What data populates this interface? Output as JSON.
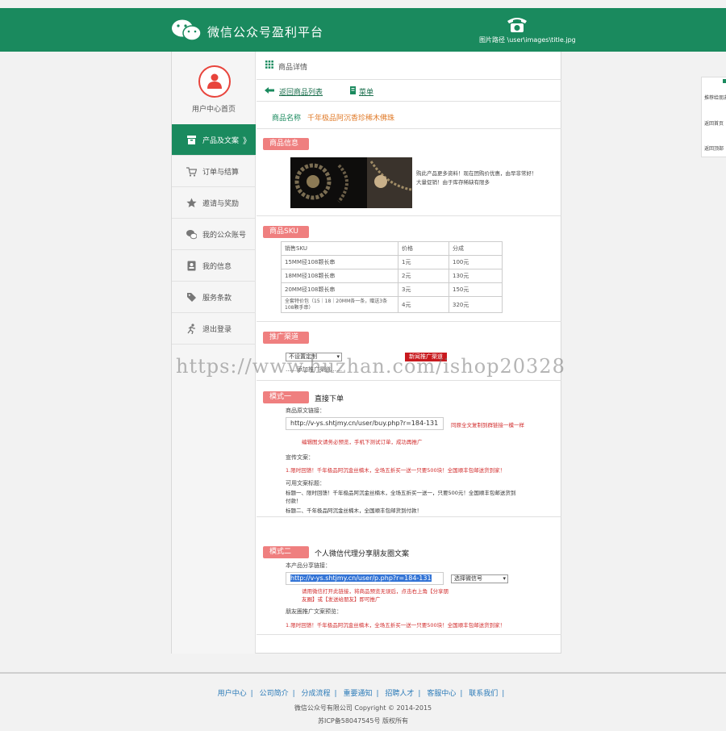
{
  "header": {
    "title": "微信公众号盈利平台",
    "image_path": "图片路径 \\user\\images\\title.jpg"
  },
  "sidebar": {
    "user_home": "用户中心首页",
    "items": [
      {
        "label": "产品及文案",
        "arrow": "》"
      },
      {
        "label": "订单与结算"
      },
      {
        "label": "邀请与奖励"
      },
      {
        "label": "我的公众账号"
      },
      {
        "label": "我的信息"
      },
      {
        "label": "服务条款"
      },
      {
        "label": "退出登录"
      }
    ]
  },
  "main": {
    "section_title": "商品详情",
    "back_link": "返回商品列表",
    "list_link": "菜单",
    "product_name_label": "商品名称",
    "product_name": "千年极品阿沉香珍稀木佛珠",
    "info_badge": "商品信息",
    "description": "购此产品更多资料！现在团购价优惠，由早非常好！大量促销！由于库存稀缺有限多",
    "sku_badge": "商品SKU",
    "sku_table": {
      "headers": [
        "销售SKU",
        "价格",
        "分成"
      ],
      "rows": [
        [
          "15MM径108颗长串",
          "1元",
          "100元"
        ],
        [
          "18MM径108颗长串",
          "2元",
          "130元"
        ],
        [
          "20MM径108颗长串",
          "3元",
          "150元"
        ],
        [
          "全套特价包（15｜18｜20MM各一条，赠送3条108颗手串）",
          "4元",
          "320元"
        ]
      ]
    },
    "promo_badge": "推广渠道",
    "promo_select": "不设置定制",
    "promo_button": "新闻推广渠道",
    "promo_note": "……添加推广渠道……",
    "mode1": {
      "badge": "模式一",
      "title": "直接下单",
      "url_label": "商品原文链接：",
      "url": "http://v-ys.shtjmy.cn/user/buy.php?r=184-131",
      "copy_hint": "同原全文复制到群链接一模一样",
      "warn": "编辑图文请务必预览，手机下测试订单，成功再推广",
      "copy_label": "宣传文案：",
      "copy_text": "1.限时回馈！千年极品阿沉金丝楠木，全场五折买一送一只要500块！全国顺丰包邮送货到家！",
      "titles_label": "可用文案标题：",
      "title1": "标题一、限时回馈！千年极品阿沉金丝楠木，全场五折买一送一，只要500元！全国顺丰包邮送货到付款！",
      "title2": "标题二、千年极品阿沉金丝楠木，全国顺丰包邮货到付款！"
    },
    "mode2": {
      "badge": "模式二",
      "title": "个人微信代理分享朋友圈文案",
      "url_label": "本产品分享链接：",
      "url": "http://v-ys.shtjmy.cn/user/p.php?r=184-131",
      "select": "选择微信号",
      "warn": "请用微信打开此链接，将商品预览无误后，点击右上角【分享朋友圈】或【发送给朋友】即可推广",
      "copy_label": "朋友圈推广文案预览：",
      "copy_text": "1.限时回馈！千年极品阿沉金丝楠木，全场五折买一送一只要500块！全国顺丰包邮送货到家！"
    }
  },
  "footer": {
    "links": [
      "用户中心",
      "公司简介",
      "分成流程",
      "重要通知",
      "招聘人才",
      "客服中心",
      "联系我们"
    ],
    "company": "微信公众号有限公司   Copyright © 2014-2015",
    "icp": "苏ICP备58047545号 版权所有"
  },
  "float_panel": {
    "items": [
      "推荐给朋友",
      "返回首页",
      "返回顶部"
    ]
  },
  "watermark": "https://www.huzhan.com/ishop20328",
  "colors": {
    "brand": "#1a8a5e",
    "badge": "#ef7f7f",
    "accent_red": "#d12b2b"
  }
}
